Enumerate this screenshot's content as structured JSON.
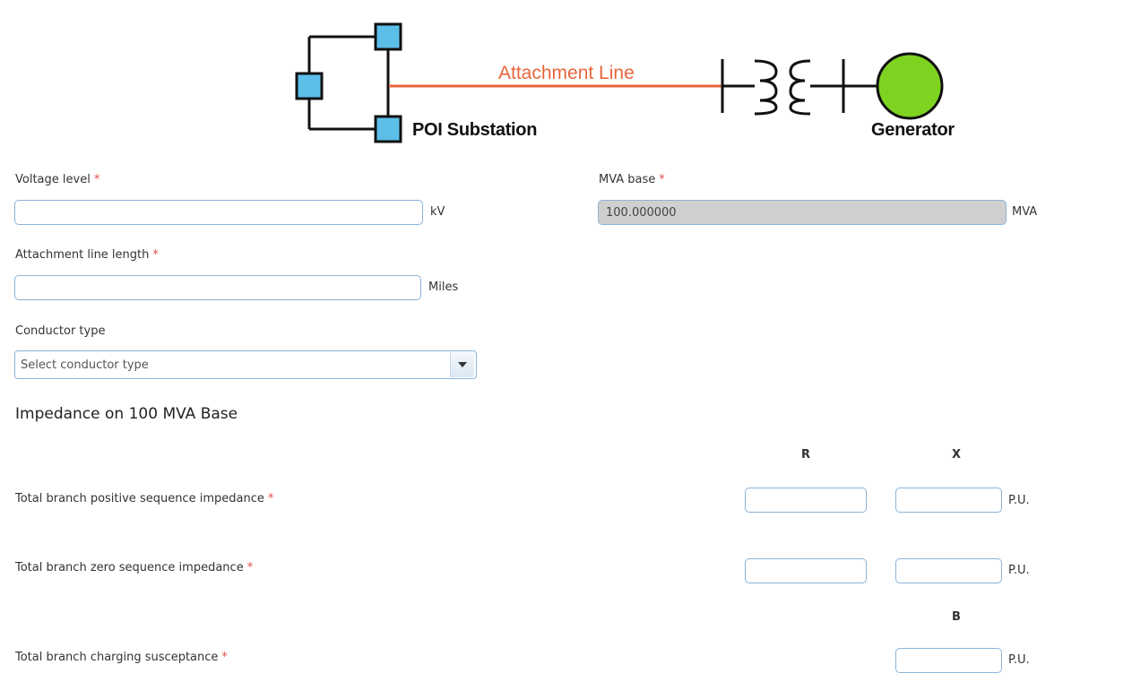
{
  "diagram": {
    "line_label": "Attachment Line",
    "poi_label": "POI Substation",
    "generator_label": "Generator",
    "colors": {
      "line": "#e8663c",
      "bus_fill": "#5bbfe9",
      "generator": "#7ed321"
    }
  },
  "form": {
    "voltage": {
      "label": "Voltage level",
      "value": "",
      "unit": "kV"
    },
    "mva_base": {
      "label": "MVA base",
      "value": "100.000000",
      "unit": "MVA"
    },
    "line_length": {
      "label": "Attachment line length",
      "value": "",
      "unit": "Miles"
    },
    "conductor": {
      "label": "Conductor type",
      "selected": "Select conductor type"
    },
    "required_mark": "*"
  },
  "impedance": {
    "title": "Impedance on 100 MVA Base",
    "col_r": "R",
    "col_x": "X",
    "col_b": "B",
    "unit": "P.U.",
    "rows": {
      "positive": {
        "label": "Total branch positive sequence impedance"
      },
      "zero": {
        "label": "Total branch zero sequence impedance"
      },
      "charging": {
        "label": "Total branch charging susceptance"
      }
    }
  }
}
